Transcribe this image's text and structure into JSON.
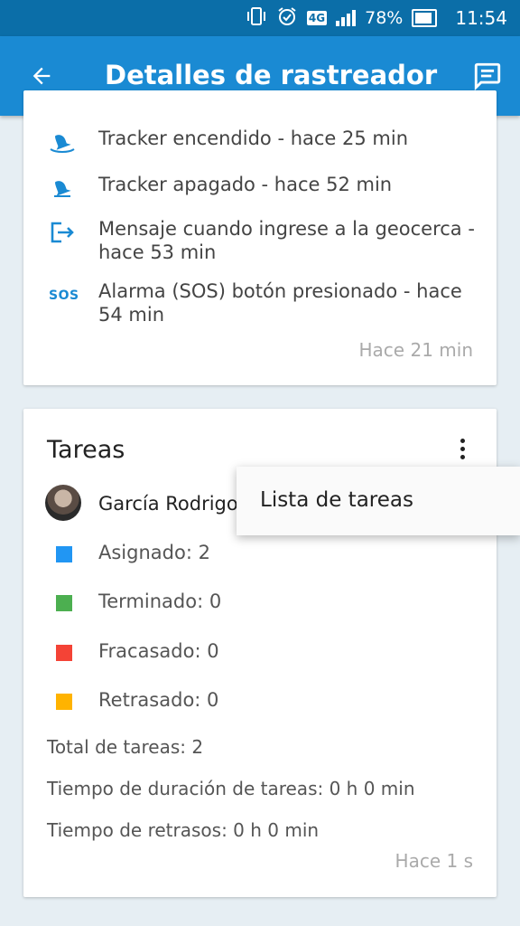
{
  "status_bar": {
    "network": "4G",
    "battery": "78%",
    "time": "11:54"
  },
  "app_bar": {
    "title": "Detalles de rastreador",
    "back_icon": "arrow-back-icon",
    "action_icon": "chat-icon"
  },
  "events_card": {
    "events": [
      {
        "icon": "bell-icon",
        "text": "Tracker encendido - hace 25 min"
      },
      {
        "icon": "bell-icon",
        "text": "Tracker apagado - hace 52 min"
      },
      {
        "icon": "geofence-enter-icon",
        "text": "Mensaje cuando ingrese a la geocerca - hace 53 min"
      },
      {
        "icon": "sos-icon",
        "icon_text": "SOS",
        "text": "Alarma (SOS) botón presionado - hace 54 min"
      }
    ],
    "updated": "Hace 21 min"
  },
  "tasks_card": {
    "title": "Tareas",
    "user": "García Rodrigo",
    "statuses": [
      {
        "label": "Asignado: 2",
        "color": "#2196F3"
      },
      {
        "label": "Terminado: 0",
        "color": "#4CAF50"
      },
      {
        "label": "Fracasado: 0",
        "color": "#F44336"
      },
      {
        "label": "Retrasado: 0",
        "color": "#FFB300"
      }
    ],
    "total": "Total de tareas: 2",
    "duration": "Tiempo de duración de tareas: 0 h 0 min",
    "delays": "Tiempo de retrasos: 0 h 0 min",
    "updated": "Hace 1 s"
  },
  "popup_menu": {
    "items": [
      "Lista de tareas"
    ]
  },
  "colors": {
    "primary": "#1a8ad3",
    "status_bar": "#0b6ea8"
  }
}
